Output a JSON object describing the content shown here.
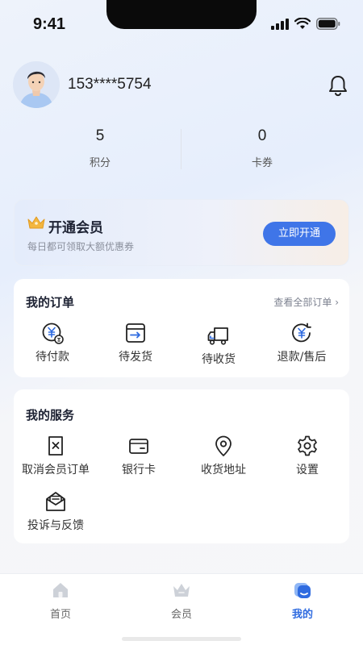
{
  "status_bar": {
    "time": "9:41"
  },
  "profile": {
    "phone": "153****5754"
  },
  "stats": [
    {
      "value": "5",
      "label": "积分"
    },
    {
      "value": "0",
      "label": "卡券"
    }
  ],
  "member": {
    "title": "开通会员",
    "subtitle": "每日都可领取大额优惠券",
    "button": "立即开通"
  },
  "orders": {
    "title": "我的订单",
    "view_all": "查看全部订单 ›",
    "items": [
      {
        "label": "待付款",
        "icon": "pending-payment-icon"
      },
      {
        "label": "待发货",
        "icon": "pending-shipment-icon"
      },
      {
        "label": "待收货",
        "icon": "truck-icon"
      },
      {
        "label": "退款/售后",
        "icon": "refund-icon"
      }
    ]
  },
  "services": {
    "title": "我的服务",
    "items": [
      {
        "label": "取消会员订单",
        "icon": "cancel-order-icon"
      },
      {
        "label": "银行卡",
        "icon": "bank-card-icon"
      },
      {
        "label": "收货地址",
        "icon": "location-icon"
      },
      {
        "label": "设置",
        "icon": "gear-icon"
      },
      {
        "label": "投诉与反馈",
        "icon": "feedback-icon"
      }
    ]
  },
  "tabs": [
    {
      "label": "首页",
      "active": false
    },
    {
      "label": "会员",
      "active": false
    },
    {
      "label": "我的",
      "active": true
    }
  ],
  "colors": {
    "accent": "#2f6be0",
    "button": "#3f75e8"
  }
}
